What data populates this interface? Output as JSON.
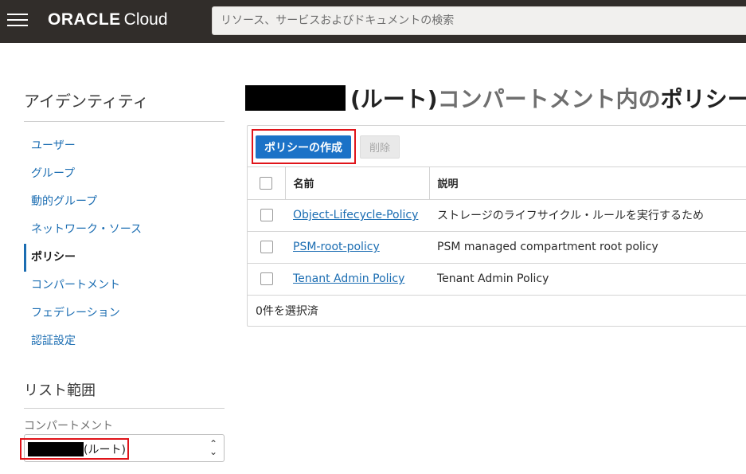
{
  "header": {
    "brand": "ORACLE",
    "product": "Cloud",
    "search_placeholder": "リソース、サービスおよびドキュメントの検索"
  },
  "sidebar": {
    "title": "アイデンティティ",
    "items": [
      {
        "label": "ユーザー"
      },
      {
        "label": "グループ"
      },
      {
        "label": "動的グループ"
      },
      {
        "label": "ネットワーク・ソース"
      },
      {
        "label": "ポリシー",
        "active": true
      },
      {
        "label": "コンパートメント"
      },
      {
        "label": "フェデレーション"
      },
      {
        "label": "認証設定"
      }
    ],
    "scope": {
      "title": "リスト範囲",
      "compartment_label": "コンパートメント",
      "selected_value": "(ルート)"
    }
  },
  "main": {
    "title_root": "(ルート)",
    "title_mid": "コンパートメント内の",
    "title_end": "ポリシー",
    "toolbar": {
      "create_label": "ポリシーの作成",
      "delete_label": "削除"
    },
    "table": {
      "columns": [
        "名前",
        "説明"
      ],
      "rows": [
        {
          "name": "Object-Lifecycle-Policy",
          "description": "ストレージのライフサイクル・ルールを実行するため"
        },
        {
          "name": "PSM-root-policy",
          "description": "PSM managed compartment root policy"
        },
        {
          "name": "Tenant Admin Policy",
          "description": "Tenant Admin Policy"
        }
      ]
    },
    "selection_status": "0件を選択済"
  },
  "icons": {
    "menu": "hamburger-icon",
    "select": "chevron-up-down-icon"
  },
  "colors": {
    "topbar": "#312d2a",
    "primary": "#1b72c7",
    "link": "#1b6db2",
    "highlight": "#e0141a"
  }
}
